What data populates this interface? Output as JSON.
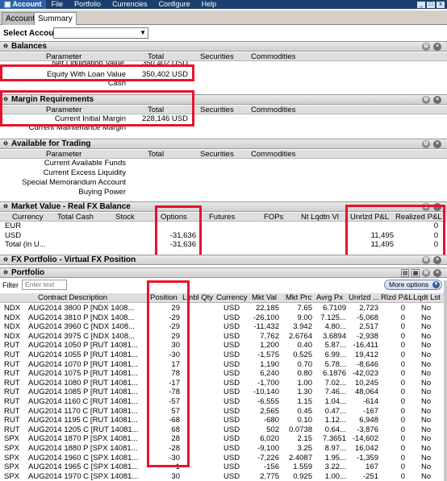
{
  "menubar": {
    "app": "Account",
    "items": [
      "File",
      "Portfolio",
      "Currencies",
      "Configure",
      "Help"
    ]
  },
  "tabs": [
    "Account",
    "Summary"
  ],
  "select_account": {
    "label": "Select Account",
    "value": ""
  },
  "balances": {
    "title": "Balances",
    "headers": [
      "Parameter",
      "Total",
      "Securities",
      "Commodities"
    ],
    "rows": [
      {
        "param": "Net Liquidation Value",
        "total": "350,402 USD"
      },
      {
        "param": "Equity With Loan Value",
        "total": "350,402 USD"
      },
      {
        "param": "Cash",
        "total": ""
      }
    ]
  },
  "margin": {
    "title": "Margin Requirements",
    "headers": [
      "Parameter",
      "Total",
      "Securities",
      "Commodities"
    ],
    "rows": [
      {
        "param": "Current Initial Margin",
        "total": "228,146 USD"
      },
      {
        "param": "Current Maintenance Margin",
        "total": ""
      }
    ]
  },
  "available": {
    "title": "Available for Trading",
    "headers": [
      "Parameter",
      "Total",
      "Securities",
      "Commodities"
    ],
    "rows": [
      "Current Available Funds",
      "Current Excess Liquidity",
      "Special Memorandum Account",
      "Buying Power"
    ]
  },
  "market_value": {
    "title": "Market Value - Real FX Balance",
    "headers": [
      "Currency",
      "Total Cash",
      "Stock",
      "Options",
      "Futures",
      "FOPs",
      "Nt Lqdtn Vl",
      "Unrlzd P&L",
      "Realized P&L"
    ],
    "rows": [
      {
        "currency": "EUR",
        "options": "",
        "unrlzd": "",
        "realized": "0"
      },
      {
        "currency": "USD",
        "options": "-31,636",
        "unrlzd": "11,495",
        "realized": "0"
      },
      {
        "currency": "Total (in U...",
        "options": "-31,636",
        "unrlzd": "11,495",
        "realized": "0"
      }
    ]
  },
  "fx_portfolio": {
    "title": "FX Portfolio - Virtual FX Position"
  },
  "portfolio": {
    "title": "Portfolio",
    "filter_label": "Filter",
    "filter_placeholder": "Enter text",
    "more_options": "More options",
    "headers": [
      "Contract Description",
      "Position",
      "Lmbl Qty",
      "Currency",
      "Mkt Val",
      "Mkt Prc",
      "Avrg Px",
      "Unrlzd ...",
      "Rlzd P&L",
      "Lqdt Lst"
    ],
    "rows": [
      {
        "sym": "NDX",
        "desc": "AUG2014 3800 P [NDX  1408...",
        "pos": "29",
        "cur": "USD",
        "mval": "22,185",
        "mprc": "7.65",
        "avg": "6.7109",
        "unr": "2,723",
        "rlz": "0",
        "lqd": "No"
      },
      {
        "sym": "NDX",
        "desc": "AUG2014 3810 P [NDX  1408...",
        "pos": "-29",
        "cur": "USD",
        "mval": "-26,100",
        "mprc": "9.00",
        "avg": "7.125...",
        "unr": "-5,068",
        "rlz": "0",
        "lqd": "No"
      },
      {
        "sym": "NDX",
        "desc": "AUG2014 3960 C [NDX  1408...",
        "pos": "-29",
        "cur": "USD",
        "mval": "-11,432",
        "mprc": "3.942",
        "avg": "4.80...",
        "unr": "2,517",
        "rlz": "0",
        "lqd": "No"
      },
      {
        "sym": "NDX",
        "desc": "AUG2014 3975 C [NDX  1408...",
        "pos": "29",
        "cur": "USD",
        "mval": "7,762",
        "mprc": "2.6764",
        "avg": "3.6894",
        "unr": "-2,938",
        "rlz": "0",
        "lqd": "No"
      },
      {
        "sym": "RUT",
        "desc": "AUG2014 1050 P [RUT  14081...",
        "pos": "30",
        "cur": "USD",
        "mval": "1,200",
        "mprc": "0.40",
        "avg": "5.87...",
        "unr": "-16,411",
        "rlz": "0",
        "lqd": "No"
      },
      {
        "sym": "RUT",
        "desc": "AUG2014 1055 P [RUT  14081...",
        "pos": "-30",
        "cur": "USD",
        "mval": "-1,575",
        "mprc": "0.525",
        "avg": "6.99...",
        "unr": "19,412",
        "rlz": "0",
        "lqd": "No"
      },
      {
        "sym": "RUT",
        "desc": "AUG2014 1070 P [RUT  14081...",
        "pos": "17",
        "cur": "USD",
        "mval": "1,190",
        "mprc": "0.70",
        "avg": "5.78...",
        "unr": "-8,646",
        "rlz": "0",
        "lqd": "No"
      },
      {
        "sym": "RUT",
        "desc": "AUG2014 1075 P [RUT  14081...",
        "pos": "78",
        "cur": "USD",
        "mval": "6,240",
        "mprc": "0.80",
        "avg": "6.1876",
        "unr": "-42,023",
        "rlz": "0",
        "lqd": "No"
      },
      {
        "sym": "RUT",
        "desc": "AUG2014 1080 P [RUT  14081...",
        "pos": "-17",
        "cur": "USD",
        "mval": "-1,700",
        "mprc": "1.00",
        "avg": "7.02...",
        "unr": "10,245",
        "rlz": "0",
        "lqd": "No"
      },
      {
        "sym": "RUT",
        "desc": "AUG2014 1085 P [RUT  14081...",
        "pos": "-78",
        "cur": "USD",
        "mval": "-10,140",
        "mprc": "1.30",
        "avg": "7.46...",
        "unr": "48,064",
        "rlz": "0",
        "lqd": "No"
      },
      {
        "sym": "RUT",
        "desc": "AUG2014 1160 C [RUT  14081...",
        "pos": "-57",
        "cur": "USD",
        "mval": "-6,555",
        "mprc": "1.15",
        "avg": "1.04...",
        "unr": "-614",
        "rlz": "0",
        "lqd": "No"
      },
      {
        "sym": "RUT",
        "desc": "AUG2014 1170 C [RUT  14081...",
        "pos": "57",
        "cur": "USD",
        "mval": "2,565",
        "mprc": "0.45",
        "avg": "0.47...",
        "unr": "-167",
        "rlz": "0",
        "lqd": "No"
      },
      {
        "sym": "RUT",
        "desc": "AUG2014 1195 C [RUT  14081...",
        "pos": "-68",
        "cur": "USD",
        "mval": "-680",
        "mprc": "0.10",
        "avg": "1.12...",
        "unr": "6,948",
        "rlz": "0",
        "lqd": "No"
      },
      {
        "sym": "RUT",
        "desc": "AUG2014 1205 C [RUT  14081...",
        "pos": "68",
        "cur": "USD",
        "mval": "502",
        "mprc": "0.0738",
        "avg": "0.64...",
        "unr": "-3,876",
        "rlz": "0",
        "lqd": "No"
      },
      {
        "sym": "SPX",
        "desc": "AUG2014 1870 P [SPX  14081...",
        "pos": "28",
        "cur": "USD",
        "mval": "6,020",
        "mprc": "2.15",
        "avg": "7.3651",
        "unr": "-14,602",
        "rlz": "0",
        "lqd": "No"
      },
      {
        "sym": "SPX",
        "desc": "AUG2014 1880 P [SPX  14081...",
        "pos": "-28",
        "cur": "USD",
        "mval": "-9,100",
        "mprc": "3.25",
        "avg": "8.97...",
        "unr": "16,042",
        "rlz": "0",
        "lqd": "No"
      },
      {
        "sym": "SPX",
        "desc": "AUG2014 1960 C [SPX  14081...",
        "pos": "-30",
        "cur": "USD",
        "mval": "-7,226",
        "mprc": "2.4087",
        "avg": "1.95...",
        "unr": "-1,359",
        "rlz": "0",
        "lqd": "No"
      },
      {
        "sym": "SPX",
        "desc": "AUG2014 1965 C [SPX  14081...",
        "pos": "-1",
        "cur": "USD",
        "mval": "-156",
        "mprc": "1.559",
        "avg": "3.22...",
        "unr": "167",
        "rlz": "0",
        "lqd": "No"
      },
      {
        "sym": "SPX",
        "desc": "AUG2014 1970 C [SPX  14081...",
        "pos": "30",
        "cur": "USD",
        "mval": "2,775",
        "mprc": "0.925",
        "avg": "1.00...",
        "unr": "-251",
        "rlz": "0",
        "lqd": "No"
      },
      {
        "sym": "SPX",
        "desc": "AUG2014 1975 C [SPX  14081...",
        "pos": "1",
        "cur": "USD",
        "mval": "56",
        "mprc": "0.5616",
        "avg": "1.80...",
        "unr": "-124",
        "rlz": "0",
        "lqd": "No"
      }
    ]
  },
  "colors": {
    "menubar": "#1b3f6e",
    "highlight": "#e8132a"
  }
}
